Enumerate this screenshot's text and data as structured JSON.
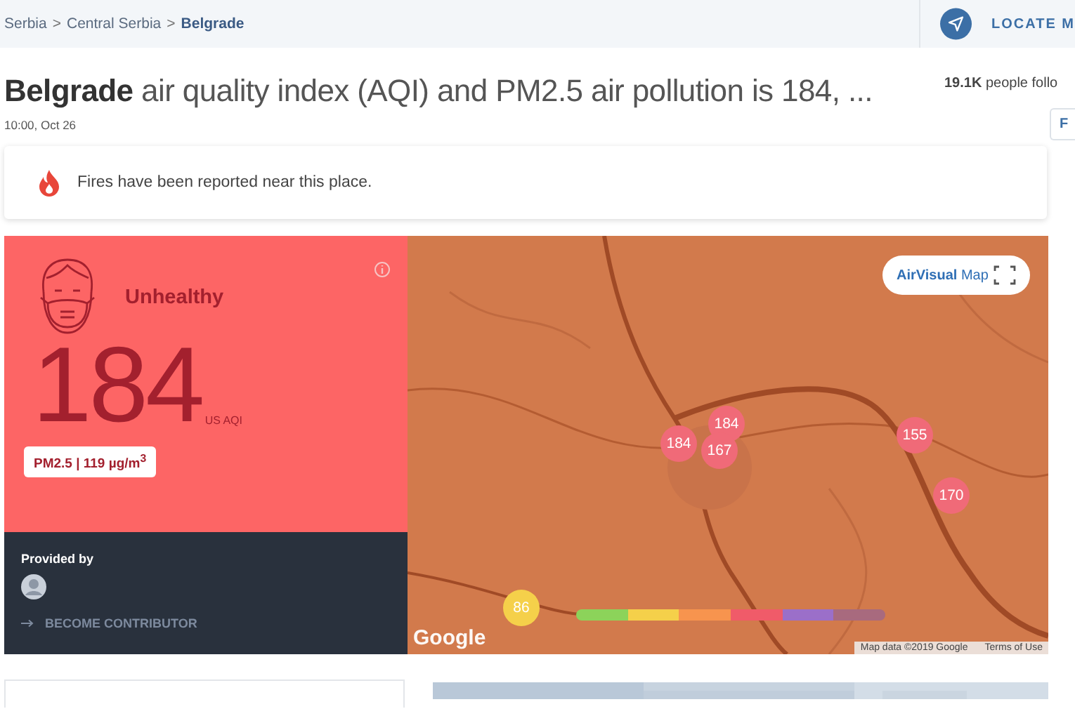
{
  "breadcrumb": [
    {
      "label": "Serbia",
      "current": false
    },
    {
      "label": "Central Serbia",
      "current": false
    },
    {
      "label": "Belgrade",
      "current": true
    }
  ],
  "breadcrumb_separator": ">",
  "locate_button": {
    "label": "LOCATE M"
  },
  "title": "**Belgrade** air quality index (AQI) and PM2.5 air pollution is 184, ...",
  "timestamp": "10:00, Oct 26",
  "followers": "**19.1K** people follo",
  "follow_button": {
    "label": "F"
  },
  "alert": {
    "text": "Fires have been reported near this place."
  },
  "aqi_card": {
    "status": "Unhealthy",
    "value": "184",
    "unit": "US AQI",
    "pollutant": "PM2.5 | 119 µg/m$^{3}$",
    "provided_by": "Provided by",
    "contributor_link": "BECOME CONTRIBUTOR"
  },
  "map": {
    "brand_button": "**AirVisual** Map",
    "logo": "Google",
    "attribution": "Map data ©2019 Google",
    "terms": "Terms of Use",
    "stations": [
      {
        "value": "184",
        "color": "#f06a78"
      },
      {
        "value": "184",
        "color": "#f06a78"
      },
      {
        "value": "167",
        "color": "#f06a78"
      },
      {
        "value": "155",
        "color": "#f06a78"
      },
      {
        "value": "170",
        "color": "#f06a78"
      },
      {
        "value": "86",
        "color": "#f5d04a"
      }
    ],
    "aqi_scale": [
      {
        "color": "#8cd35a"
      },
      {
        "color": "#f5d04a"
      },
      {
        "color": "#f7944e"
      },
      {
        "color": "#f05b69"
      },
      {
        "color": "#9b6fc9"
      },
      {
        "color": "#a86a7e"
      }
    ]
  }
}
